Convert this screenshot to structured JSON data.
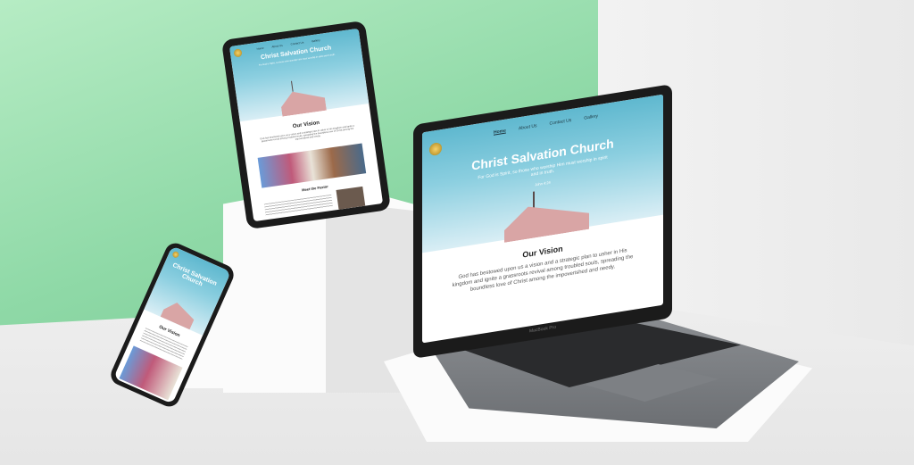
{
  "site": {
    "title": "Christ Salvation Church",
    "tagline": "For God is Spirit, so those who worship Him must worship in spirit and in truth.",
    "verse": "John 4:24",
    "nav": [
      "Home",
      "About Us",
      "Contact Us",
      "Gallery"
    ],
    "vision_heading": "Our Vision",
    "vision_text": "God has bestowed upon us a vision and a strategic plan to usher in His kingdom and ignite a grassroots revival among troubled souls, spreading the boundless love of Christ among the impoverished and needy.",
    "pastor_heading": "Meet the Pastor"
  },
  "laptop": {
    "brand": "MacBook Pro"
  },
  "colors": {
    "green_wall": "#8fd9a7",
    "sky": "#5fb8cf",
    "roof": "#d9a5a5",
    "device": "#1b1b1b"
  }
}
